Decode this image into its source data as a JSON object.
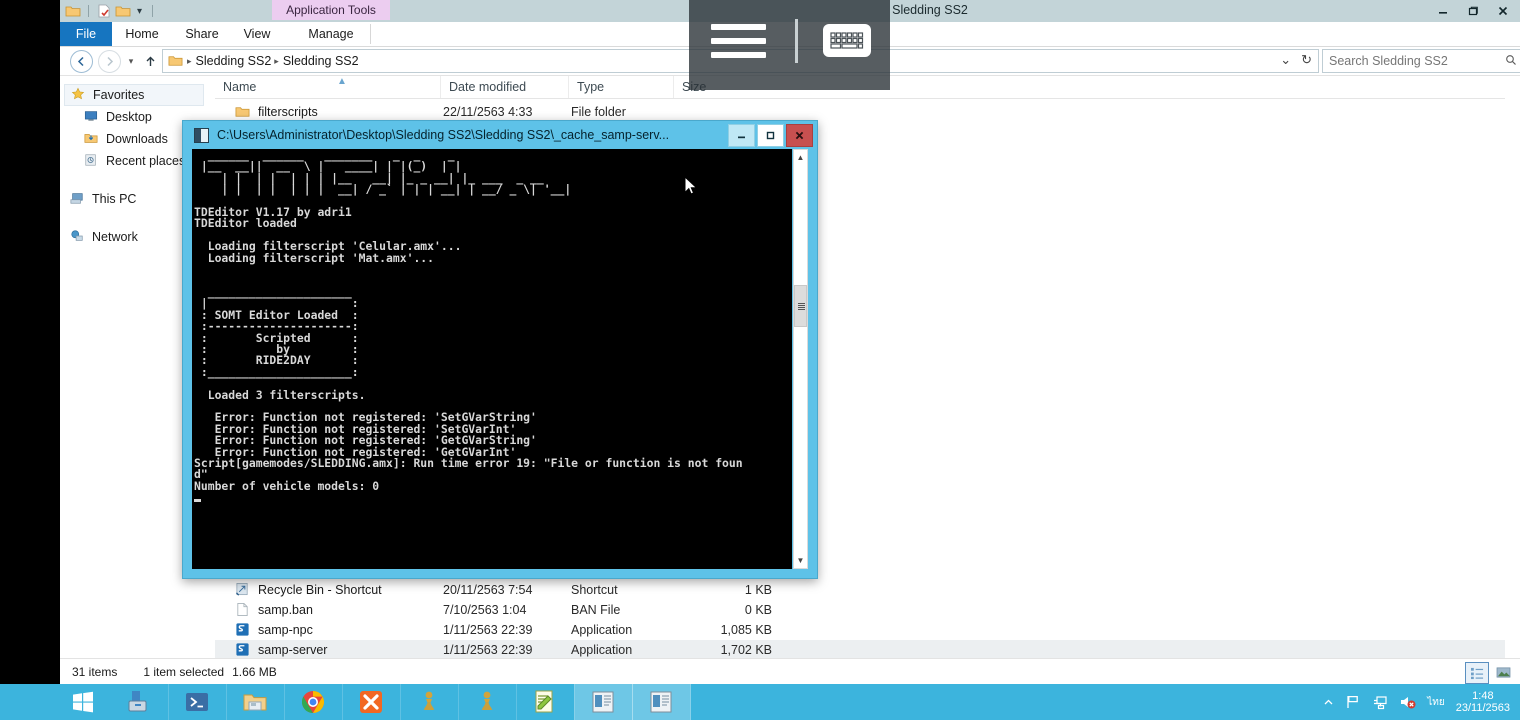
{
  "window": {
    "title": "Sledding SS2",
    "minimize": "–",
    "restore": "❐",
    "close": "✕"
  },
  "ribbon": {
    "contextual_tab": "Application Tools",
    "tabs": [
      {
        "label": "File",
        "key": "file"
      },
      {
        "label": "Home",
        "key": "home"
      },
      {
        "label": "Share",
        "key": "share"
      },
      {
        "label": "View",
        "key": "view"
      },
      {
        "label": "Manage",
        "key": "manage"
      }
    ],
    "collapse_caret": "⌄",
    "help": "?"
  },
  "address": {
    "back": "←",
    "forward": "→",
    "recent_caret": "▾",
    "up": "↑",
    "crumbs": [
      "Sledding SS2",
      "Sledding SS2"
    ],
    "crumb_sep": "▸",
    "history_caret": "⌄",
    "refresh": "↻"
  },
  "search": {
    "placeholder": "Search Sledding SS2",
    "icon": "search-icon"
  },
  "nav_pane": {
    "items": [
      {
        "label": "Favorites",
        "level": 1,
        "icon": "star-icon",
        "selected": true
      },
      {
        "label": "Desktop",
        "level": 2,
        "icon": "desktop-icon"
      },
      {
        "label": "Downloads",
        "level": 2,
        "icon": "downloads-icon"
      },
      {
        "label": "Recent places",
        "level": 2,
        "icon": "recent-icon"
      },
      {
        "label": "This PC",
        "level": 1,
        "icon": "pc-icon"
      },
      {
        "label": "Network",
        "level": 1,
        "icon": "network-icon"
      }
    ]
  },
  "file_list": {
    "columns": [
      "Name",
      "Date modified",
      "Type",
      "Size"
    ],
    "rows": [
      {
        "name": "filterscripts",
        "date": "22/11/2563 4:33",
        "type": "File folder",
        "size": "",
        "icon": "folder-icon",
        "selected": false
      },
      {
        "name": "Recycle Bin - Shortcut",
        "date": "20/11/2563 7:54",
        "type": "Shortcut",
        "size": "1 KB",
        "icon": "shortcut-icon",
        "selected": false
      },
      {
        "name": "samp.ban",
        "date": "7/10/2563 1:04",
        "type": "BAN File",
        "size": "0 KB",
        "icon": "file-icon",
        "selected": false
      },
      {
        "name": "samp-npc",
        "date": "1/11/2563 22:39",
        "type": "Application",
        "size": "1,085 KB",
        "icon": "app-icon",
        "selected": false
      },
      {
        "name": "samp-server",
        "date": "1/11/2563 22:39",
        "type": "Application",
        "size": "1,702 KB",
        "icon": "app-icon",
        "selected": true
      }
    ]
  },
  "status_bar": {
    "item_count": "31 items",
    "selection": "1 item selected",
    "selection_size": "1.66 MB",
    "view_details": "details-view-icon",
    "view_large": "large-icons-view-icon"
  },
  "console": {
    "title": "C:\\Users\\Administrator\\Desktop\\Sledding SS2\\Sledding SS2\\_cache_samp-serv...",
    "minimize": "–",
    "maximize": "☐",
    "close": "✕",
    "text": "  ______  ______   _______   _  _    _\n |__  __||  __  \\ |   ____| | |(_)  | |\n    | |  | |  | | | |__   __| |_ _ __| |_ ___  _ __\n    | |  | |  | | |  __| / _` | | | __| | __/ _ \\| '__|\n\nTDEditor V1.17 by adri1\nTDEditor loaded\n\n  Loading filterscript 'Celular.amx'...\n  Loading filterscript 'Mat.amx'...\n\n\n  _____________________\n |                     :\n : SOMT Editor Loaded  :\n :---------------------:\n :       Scripted      :\n :          by         :\n :       RIDE2DAY      :\n :_____________________:\n\n  Loaded 3 filterscripts.\n\n   Error: Function not registered: 'SetGVarString'\n   Error: Function not registered: 'SetGVarInt'\n   Error: Function not registered: 'GetGVarString'\n   Error: Function not registered: 'GetGVarInt'\nScript[gamemodes/SLEDDING.amx]: Run time error 19: \"File or function is not foun\nd\"\nNumber of vehicle models: 0"
  },
  "overlay": {
    "menu_icon": "hamburger-menu-icon",
    "keyboard_icon": "keyboard-icon"
  },
  "taskbar": {
    "start": "start-button",
    "items": [
      {
        "name": "server-manager",
        "icon": "server-manager-icon"
      },
      {
        "name": "powershell",
        "icon": "powershell-icon"
      },
      {
        "name": "file-explorer",
        "icon": "file-explorer-icon"
      },
      {
        "name": "google-chrome",
        "icon": "chrome-icon"
      },
      {
        "name": "xampp",
        "icon": "xampp-icon"
      },
      {
        "name": "samp-server-1",
        "icon": "pawn-icon"
      },
      {
        "name": "samp-server-2",
        "icon": "pawn-icon"
      },
      {
        "name": "notepad-plus-plus",
        "icon": "notepadpp-icon"
      },
      {
        "name": "console-window-1",
        "icon": "console-icon"
      },
      {
        "name": "console-window-2",
        "icon": "console-icon"
      }
    ],
    "tray": {
      "show_hidden": "▲",
      "flag_icon": "flag-icon",
      "network_icon": "network-tray-icon",
      "volume_icon": "volume-muted-icon",
      "language": "ไทย",
      "time": "1:48",
      "date": "23/11/2563"
    }
  },
  "colors": {
    "titlebar": "#c3d4d8",
    "file_tab": "#1675c0",
    "contextual_tab": "#eccdf0",
    "console_frame": "#5ec2e8",
    "console_close": "#c75050",
    "taskbar": "#3cb4dd",
    "selection": "#eceff1"
  }
}
